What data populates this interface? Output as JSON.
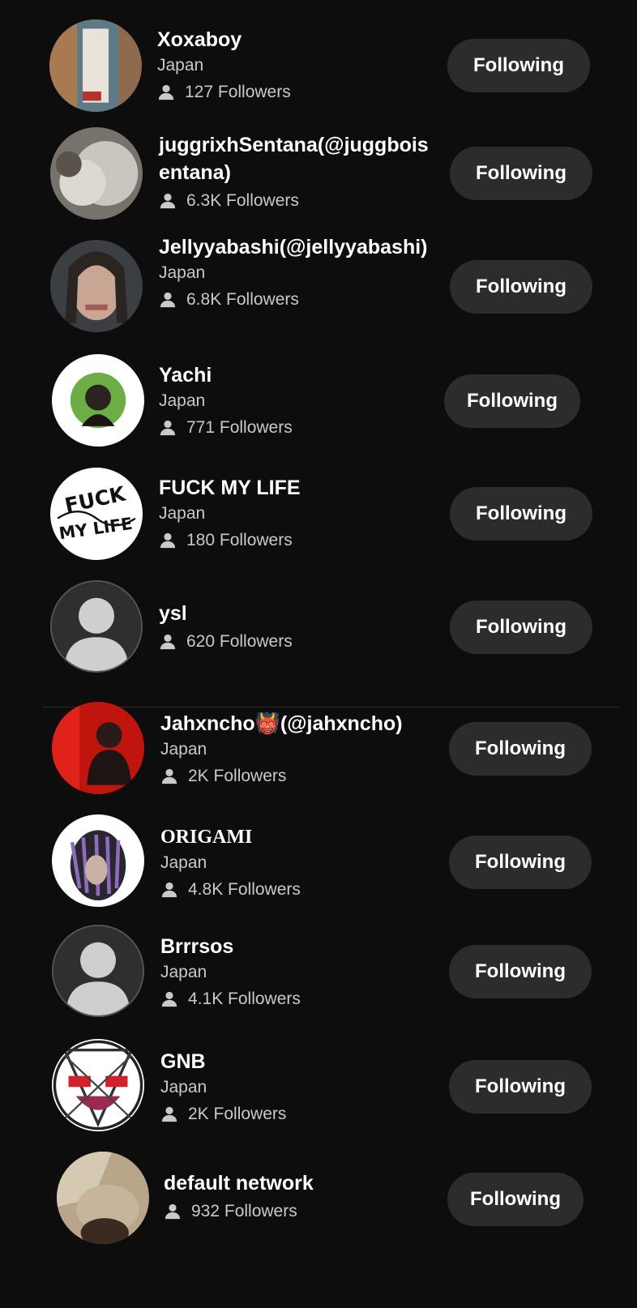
{
  "follow_list": {
    "items": [
      {
        "name": "Xoxaboy",
        "location": "Japan",
        "followers": "127 Followers",
        "button": "Following"
      },
      {
        "name": "juggrixhSentana(@juggboisentana)",
        "location": "",
        "followers": "6.3K Followers",
        "button": "Following"
      },
      {
        "name": "Jellyyabashi(@jellyyabashi)",
        "location": "Japan",
        "followers": "6.8K Followers",
        "button": "Following"
      },
      {
        "name": "Yachi",
        "location": "Japan",
        "followers": "771 Followers",
        "button": "Following"
      },
      {
        "name": "FUCK MY LIFE",
        "location": "Japan",
        "followers": "180 Followers",
        "button": "Following",
        "avatar_logo_text": "FUCK MY LIFE"
      },
      {
        "name": "ysl",
        "location": "",
        "followers": "620 Followers",
        "button": "Following"
      },
      {
        "name": "Jahxncho👹(@jahxncho)",
        "location": "Japan",
        "followers": "2K Followers",
        "button": "Following"
      },
      {
        "name": "ORIGAMI",
        "location": "Japan",
        "followers": "4.8K Followers",
        "button": "Following"
      },
      {
        "name": "Brrrsos",
        "location": "Japan",
        "followers": "4.1K Followers",
        "button": "Following"
      },
      {
        "name": "GNB",
        "location": "Japan",
        "followers": "2K Followers",
        "button": "Following"
      },
      {
        "name": "default network",
        "location": "",
        "followers": "932 Followers",
        "button": "Following"
      }
    ]
  },
  "icons": {
    "followers": "person-icon"
  },
  "colors": {
    "background": "#0d0d0e",
    "button_bg": "#2c2c2e",
    "text_primary": "#ffffff",
    "text_secondary": "#c9c9cc"
  }
}
